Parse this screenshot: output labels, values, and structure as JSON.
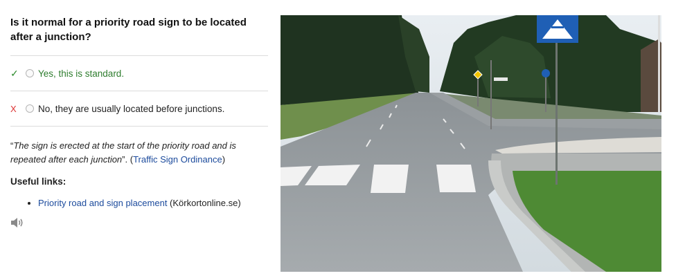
{
  "question": "Is it normal for a priority road sign to be located after a junction?",
  "answers": [
    {
      "mark": "✓",
      "text": "Yes, this is standard.",
      "status": "correct"
    },
    {
      "mark": "X",
      "text": "No, they are usually located before junctions.",
      "status": "wrong"
    }
  ],
  "explanation": {
    "quote_open": "“",
    "quote_text": "The sign is erected at the start of the priority road and is repeated after each junction",
    "quote_close": "”. (",
    "source_link": "Traffic Sign Ordinance",
    "source_close": ")"
  },
  "useful_links": {
    "heading": "Useful links:",
    "items": [
      {
        "link_text": "Priority road and sign placement",
        "suffix": " (Körkortonline.se)"
      }
    ]
  },
  "audio": {
    "icon": "speaker-icon"
  },
  "image": {
    "description_icon": "road-photo"
  },
  "colors": {
    "correct": "#2e7d2e",
    "wrong_mark": "#dd3333",
    "link": "#1b4a9c"
  }
}
